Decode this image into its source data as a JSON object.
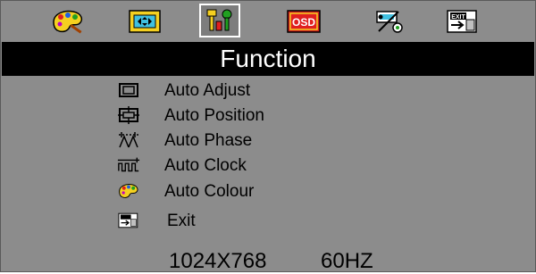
{
  "tabs": [
    {
      "icon": "palette-icon",
      "active": false
    },
    {
      "icon": "image-position-icon",
      "active": false
    },
    {
      "icon": "tools-icon",
      "active": true
    },
    {
      "icon": "osd-icon",
      "label": "OSD",
      "active": false
    },
    {
      "icon": "input-percent-icon",
      "active": false
    },
    {
      "icon": "exit-icon",
      "label": "EXIT",
      "active": false
    }
  ],
  "title": "Function",
  "menu": [
    {
      "label": "Auto Adjust",
      "icon": "monitor-icon"
    },
    {
      "label": "Auto Position",
      "icon": "position-icon"
    },
    {
      "label": "Auto Phase",
      "icon": "phase-icon"
    },
    {
      "label": "Auto Clock",
      "icon": "clock-wave-icon"
    },
    {
      "label": "Auto Colour",
      "icon": "palette-icon"
    },
    {
      "label": "Exit",
      "icon": "exit-icon"
    }
  ],
  "status": {
    "resolution": "1024X768",
    "frequency": "60HZ"
  },
  "colors": {
    "background": "#8c8c8c",
    "title_bar": "#000000",
    "title_text": "#ffffff"
  }
}
